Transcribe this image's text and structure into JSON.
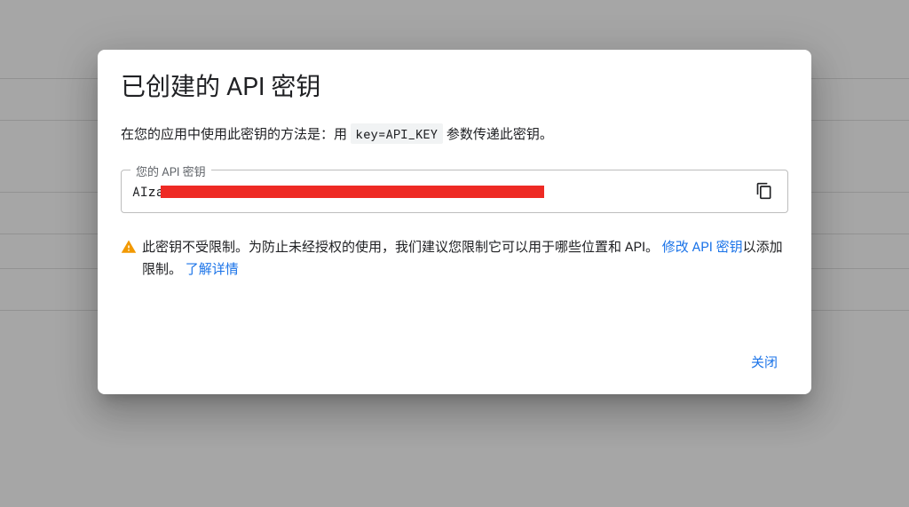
{
  "dialog": {
    "title": "已创建的 API 密钥",
    "instruction_pre": "在您的应用中使用此密钥的方法是：用 ",
    "instruction_code": "key=API_KEY",
    "instruction_post": " 参数传递此密钥。",
    "key_field_legend": "您的 API 密钥",
    "key_value_visible_prefix": "AIza",
    "warning_text_1": "此密钥不受限制。为防止未经授权的使用，我们建议您限制它可以用于哪些位置和 API。",
    "warning_link_edit": "修改 API 密钥",
    "warning_text_2": "以添加限制。",
    "warning_link_learn": "了解详情",
    "close_label": "关闭"
  }
}
